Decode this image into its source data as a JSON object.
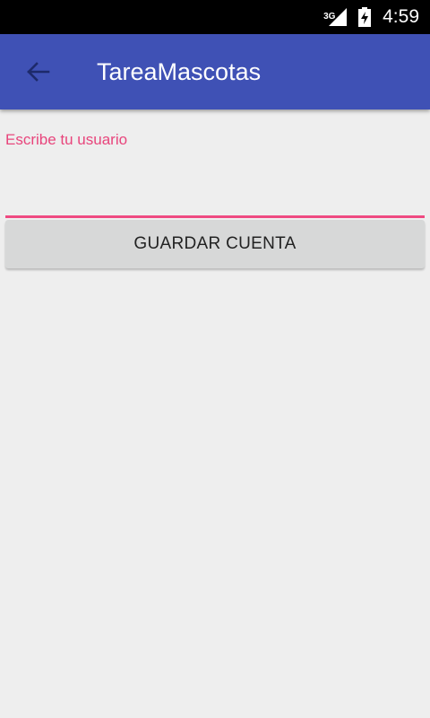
{
  "status_bar": {
    "network_type": "3G",
    "time": "4:59",
    "icons": [
      "signal-icon",
      "battery-charging-icon"
    ]
  },
  "app_bar": {
    "title": "TareaMascotas",
    "back_icon": "arrow-back-icon",
    "color": "#3f51b5"
  },
  "form": {
    "username_label": "Escribe tu usuario",
    "username_value": "",
    "accent_color": "#ef4a81"
  },
  "actions": {
    "save_label": "GUARDAR CUENTA"
  }
}
